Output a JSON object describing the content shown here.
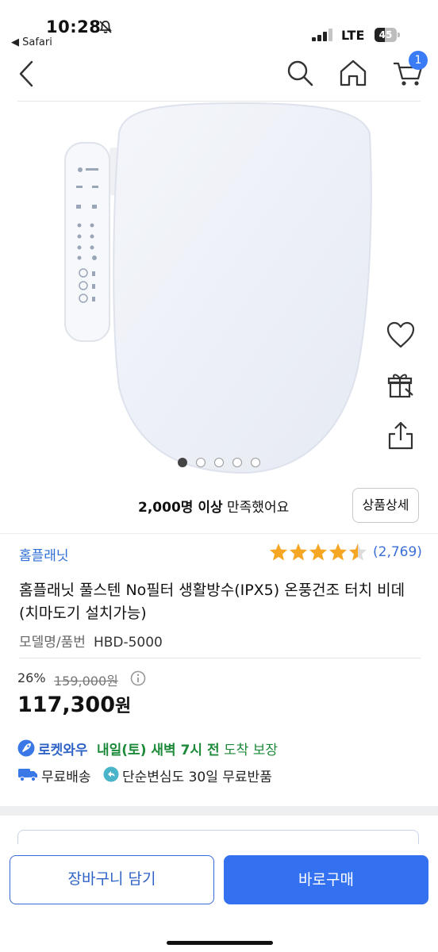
{
  "status_bar": {
    "time": "10:28",
    "back_app": "◀ Safari",
    "network": "LTE",
    "battery": "45",
    "icons": [
      "bell-muted-icon",
      "signal-icon",
      "battery-icon"
    ]
  },
  "nav": {
    "icons": [
      "chevron-left-icon",
      "search-icon",
      "home-icon",
      "cart-icon"
    ],
    "cart_count": "1"
  },
  "gallery": {
    "image": "bidet-seat-with-remote",
    "slide_count": 5,
    "active_slide": 1,
    "side_icons": [
      "heart-icon",
      "gift-icon",
      "share-icon"
    ]
  },
  "satisfaction": {
    "count_text": "2,000명 이상",
    "suffix": " 만족했어요",
    "detail_button": "상품상세"
  },
  "product": {
    "brand": "홈플래닛",
    "rating": 4.5,
    "review_count": "(2,769)",
    "title": "홈플래닛 풀스텐 No필터 생활방수(IPX5) 온풍건조 터치 비데 (치마도기 설치가능)",
    "model_label": "모델명/품번",
    "model_value": "HBD-5000",
    "discount": "26%",
    "original_price": "159,000원",
    "price": "117,300",
    "price_unit": "원"
  },
  "shipping": {
    "rocket_label": "로켓와우",
    "delivery_bold": "내일(토) 새벽 7시 전",
    "delivery_rest": " 도착 보장",
    "free_shipping": "무료배송",
    "free_return": "단순변심도 30일 무료반품"
  },
  "actions": {
    "add_to_cart": "장바구니 담기",
    "buy_now": "바로구매"
  },
  "colors": {
    "accent": "#3471f0",
    "brand": "#2f6fd6",
    "star": "#f5a623",
    "delivery": "#1d8a3a"
  }
}
